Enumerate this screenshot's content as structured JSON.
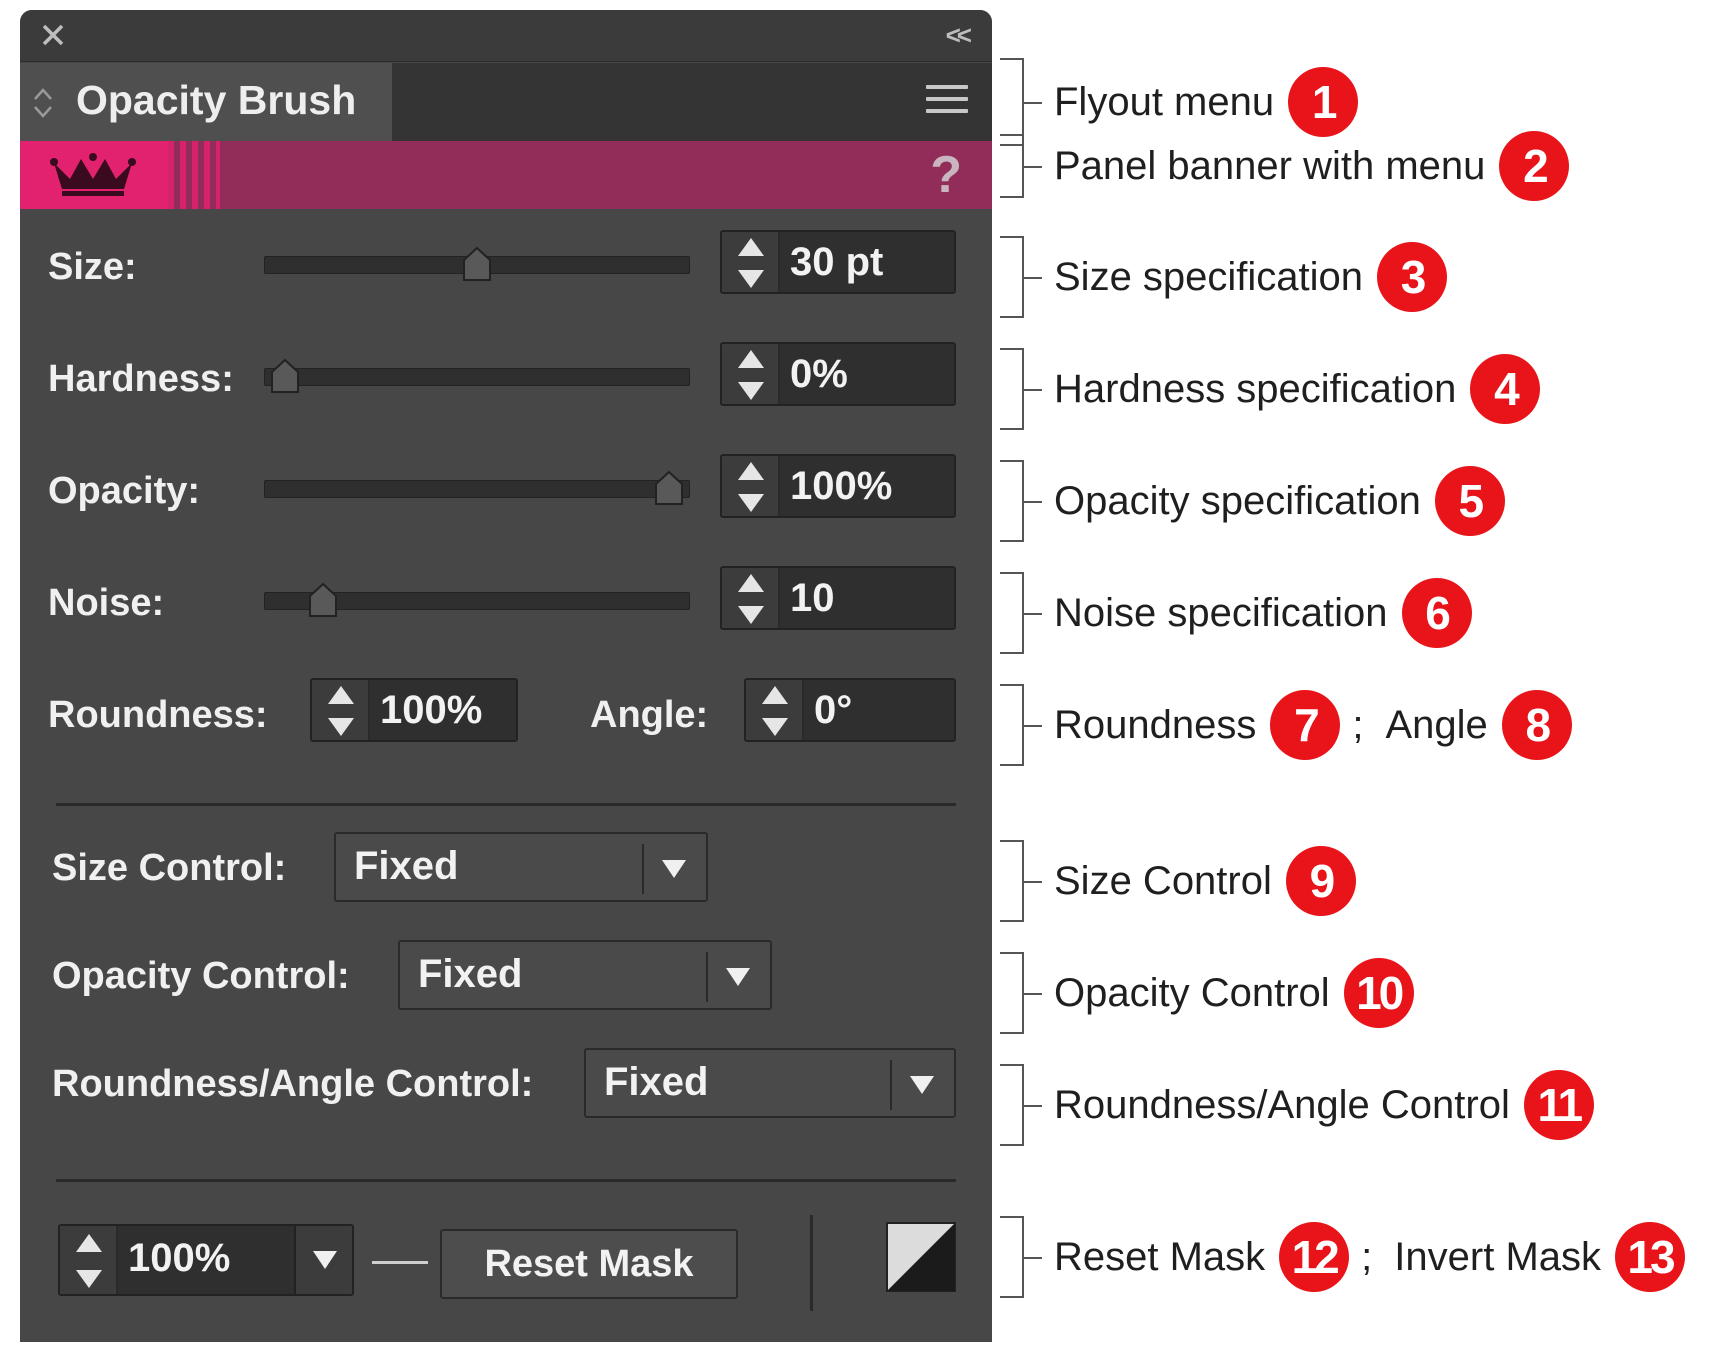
{
  "panel": {
    "close_icon": "close-icon",
    "collapse_label": "<<",
    "title": "Opacity Brush",
    "help_label": "?",
    "accent_color": "#e2216f",
    "banner_color": "#922d5a"
  },
  "rows": {
    "size": {
      "label": "Size:",
      "value": "30 pt",
      "slider_fraction": 0.5
    },
    "hardness": {
      "label": "Hardness:",
      "value": "0%",
      "slider_fraction": 0.0
    },
    "opacity": {
      "label": "Opacity:",
      "value": "100%",
      "slider_fraction": 1.0
    },
    "noise": {
      "label": "Noise:",
      "value": "10",
      "slider_fraction": 0.1
    },
    "roundness": {
      "label": "Roundness:",
      "value": "100%"
    },
    "angle": {
      "label": "Angle:",
      "value": "0°"
    }
  },
  "controls": {
    "size_control": {
      "label": "Size Control:",
      "value": "Fixed"
    },
    "opacity_control": {
      "label": "Opacity Control:",
      "value": "Fixed"
    },
    "roundness_angle_control": {
      "label": "Roundness/Angle Control:",
      "value": "Fixed"
    }
  },
  "mask": {
    "opacity_value": "100%",
    "reset_label": "Reset Mask"
  },
  "annotations": [
    {
      "text": "Flyout menu",
      "badge": "1"
    },
    {
      "text": "Panel banner with menu",
      "badge": "2"
    },
    {
      "text": "Size specification",
      "badge": "3"
    },
    {
      "text": "Hardness specification",
      "badge": "4"
    },
    {
      "text": "Opacity specification",
      "badge": "5"
    },
    {
      "text": "Noise specification",
      "badge": "6"
    },
    {
      "text": "Roundness",
      "badge": "7",
      "text2": "Angle",
      "badge2": "8"
    },
    {
      "text": "Size Control",
      "badge": "9"
    },
    {
      "text": "Opacity Control",
      "badge": "10"
    },
    {
      "text": "Roundness/Angle Control",
      "badge": "11"
    },
    {
      "text": "Reset Mask",
      "badge": "12",
      "text2": "Invert Mask",
      "badge2": "13"
    }
  ],
  "annotation_separator": ";"
}
